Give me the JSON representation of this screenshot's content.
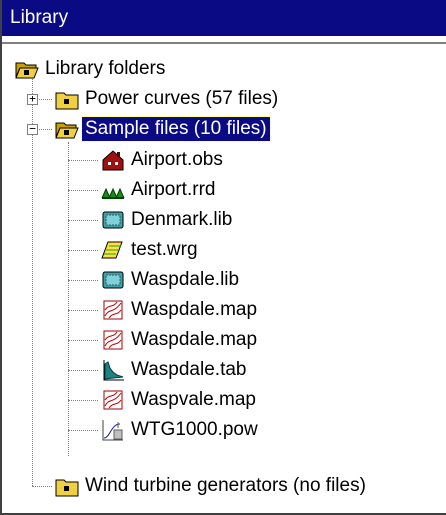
{
  "window": {
    "title": "Library"
  },
  "tree": {
    "root": {
      "label": "Library folders",
      "icon": "open-folder-icon"
    },
    "folders": [
      {
        "label": "Power curves (57 files)",
        "icon": "closed-folder-icon",
        "expanded": false,
        "expander": "+"
      },
      {
        "label": "Sample files (10 files)",
        "icon": "open-folder-icon",
        "expanded": true,
        "selected": true,
        "expander": "−"
      },
      {
        "label": "Wind turbine generators (no files)",
        "icon": "closed-folder-icon",
        "expanded": false
      }
    ],
    "sample_files": [
      {
        "label": "Airport.obs",
        "icon": "obstacle-icon"
      },
      {
        "label": "Airport.rrd",
        "icon": "roughness-icon"
      },
      {
        "label": "Denmark.lib",
        "icon": "library-icon"
      },
      {
        "label": "test.wrg",
        "icon": "resource-grid-icon"
      },
      {
        "label": "Waspdale.lib",
        "icon": "library-icon"
      },
      {
        "label": "Waspdale.map",
        "icon": "map-icon"
      },
      {
        "label": "Waspdale.map",
        "icon": "map-icon"
      },
      {
        "label": "Waspdale.tab",
        "icon": "histogram-icon"
      },
      {
        "label": "Waspvale.map",
        "icon": "map-icon"
      },
      {
        "label": "WTG1000.pow",
        "icon": "power-curve-icon"
      }
    ]
  },
  "colors": {
    "title_bg": "#0a0a84",
    "selection_bg": "#0a0a84",
    "folder": "#f0d040"
  }
}
